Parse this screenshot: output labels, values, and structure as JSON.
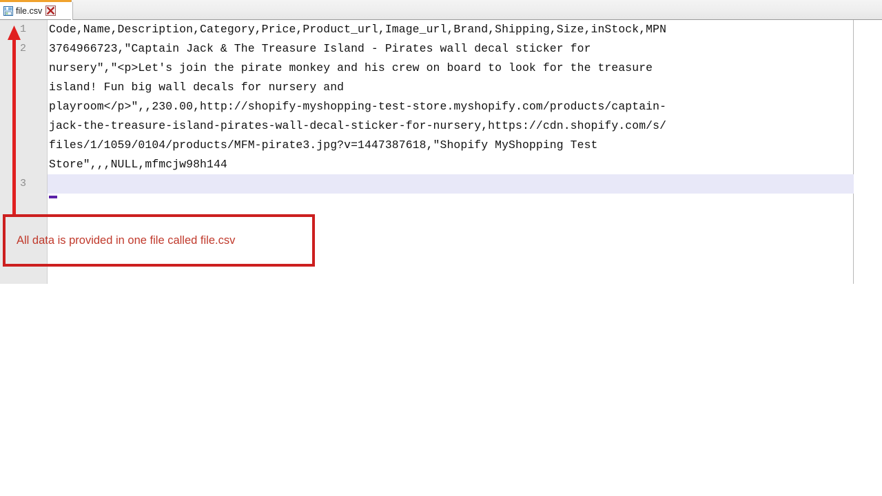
{
  "window": {
    "background_color": "#ffffff"
  },
  "tab_bar": {
    "background_color": "#f1f1f1",
    "active_accent_color": "#f0a22e",
    "tabs": [
      {
        "label": "file.csv",
        "icon": "save-floppy-icon",
        "close_icon": "close-icon",
        "active": true
      }
    ]
  },
  "editor": {
    "gutter_background": "#e8e8e8",
    "line_number_color": "#8e8e8e",
    "current_line_highlight_color": "#e8e8f8",
    "caret_color": "#5b21a8",
    "line_numbers": [
      "1",
      "2",
      "3"
    ],
    "current_line": 3,
    "lines": [
      {
        "number": "1",
        "text": "Code,Name,Description,Category,Price,Product_url,Image_url,Brand,Shipping,Size,inStock,MPN"
      },
      {
        "number": "2",
        "text": "3764966723,\"Captain Jack & The Treasure Island - Pirates wall decal sticker for nursery\",\"<p>Let's join the pirate monkey and his crew on board to look for the treasure island! Fun big wall decals for nursery and playroom</p>\",,230.00,http://shopify-myshopping-test-store.myshopify.com/products/captain-jack-the-treasure-island-pirates-wall-decal-sticker-for-nursery,https://cdn.shopify.com/s/files/1/1059/0104/products/MFM-pirate3.jpg?v=1447387618,\"Shopify MyShopping Test Store\",,,NULL,mfmcjw98h144"
      },
      {
        "number": "3",
        "text": ""
      }
    ],
    "wrapped_rows": [
      {
        "line": "1",
        "text": "Code,Name,Description,Category,Price,Product_url,Image_url,Brand,Shipping,Size,inStock,MPN",
        "highlighted": false
      },
      {
        "line": "2",
        "text": "3764966723,\"Captain Jack & The Treasure Island - Pirates wall decal sticker for",
        "highlighted": false
      },
      {
        "line": "",
        "text": "nursery\",\"<p>Let's join the pirate monkey and his crew on board to look for the treasure",
        "highlighted": false
      },
      {
        "line": "",
        "text": "island! Fun big wall decals for nursery and",
        "highlighted": false
      },
      {
        "line": "",
        "text": "playroom</p>\",,230.00,http://shopify-myshopping-test-store.myshopify.com/products/captain-",
        "highlighted": false
      },
      {
        "line": "",
        "text": "jack-the-treasure-island-pirates-wall-decal-sticker-for-nursery,https://cdn.shopify.com/s/",
        "highlighted": false
      },
      {
        "line": "",
        "text": "files/1/1059/0104/products/MFM-pirate3.jpg?v=1447387618,\"Shopify MyShopping Test",
        "highlighted": false
      },
      {
        "line": "",
        "text": "Store\",,,NULL,mfmcjw98h144",
        "highlighted": false
      },
      {
        "line": "3",
        "text": "",
        "highlighted": true
      }
    ]
  },
  "annotation": {
    "text": "All data is provided in one file called file.csv",
    "border_color": "#cc1f1f",
    "text_color": "#c0392b",
    "arrow_color": "#e02020",
    "arrow_direction": "up"
  }
}
